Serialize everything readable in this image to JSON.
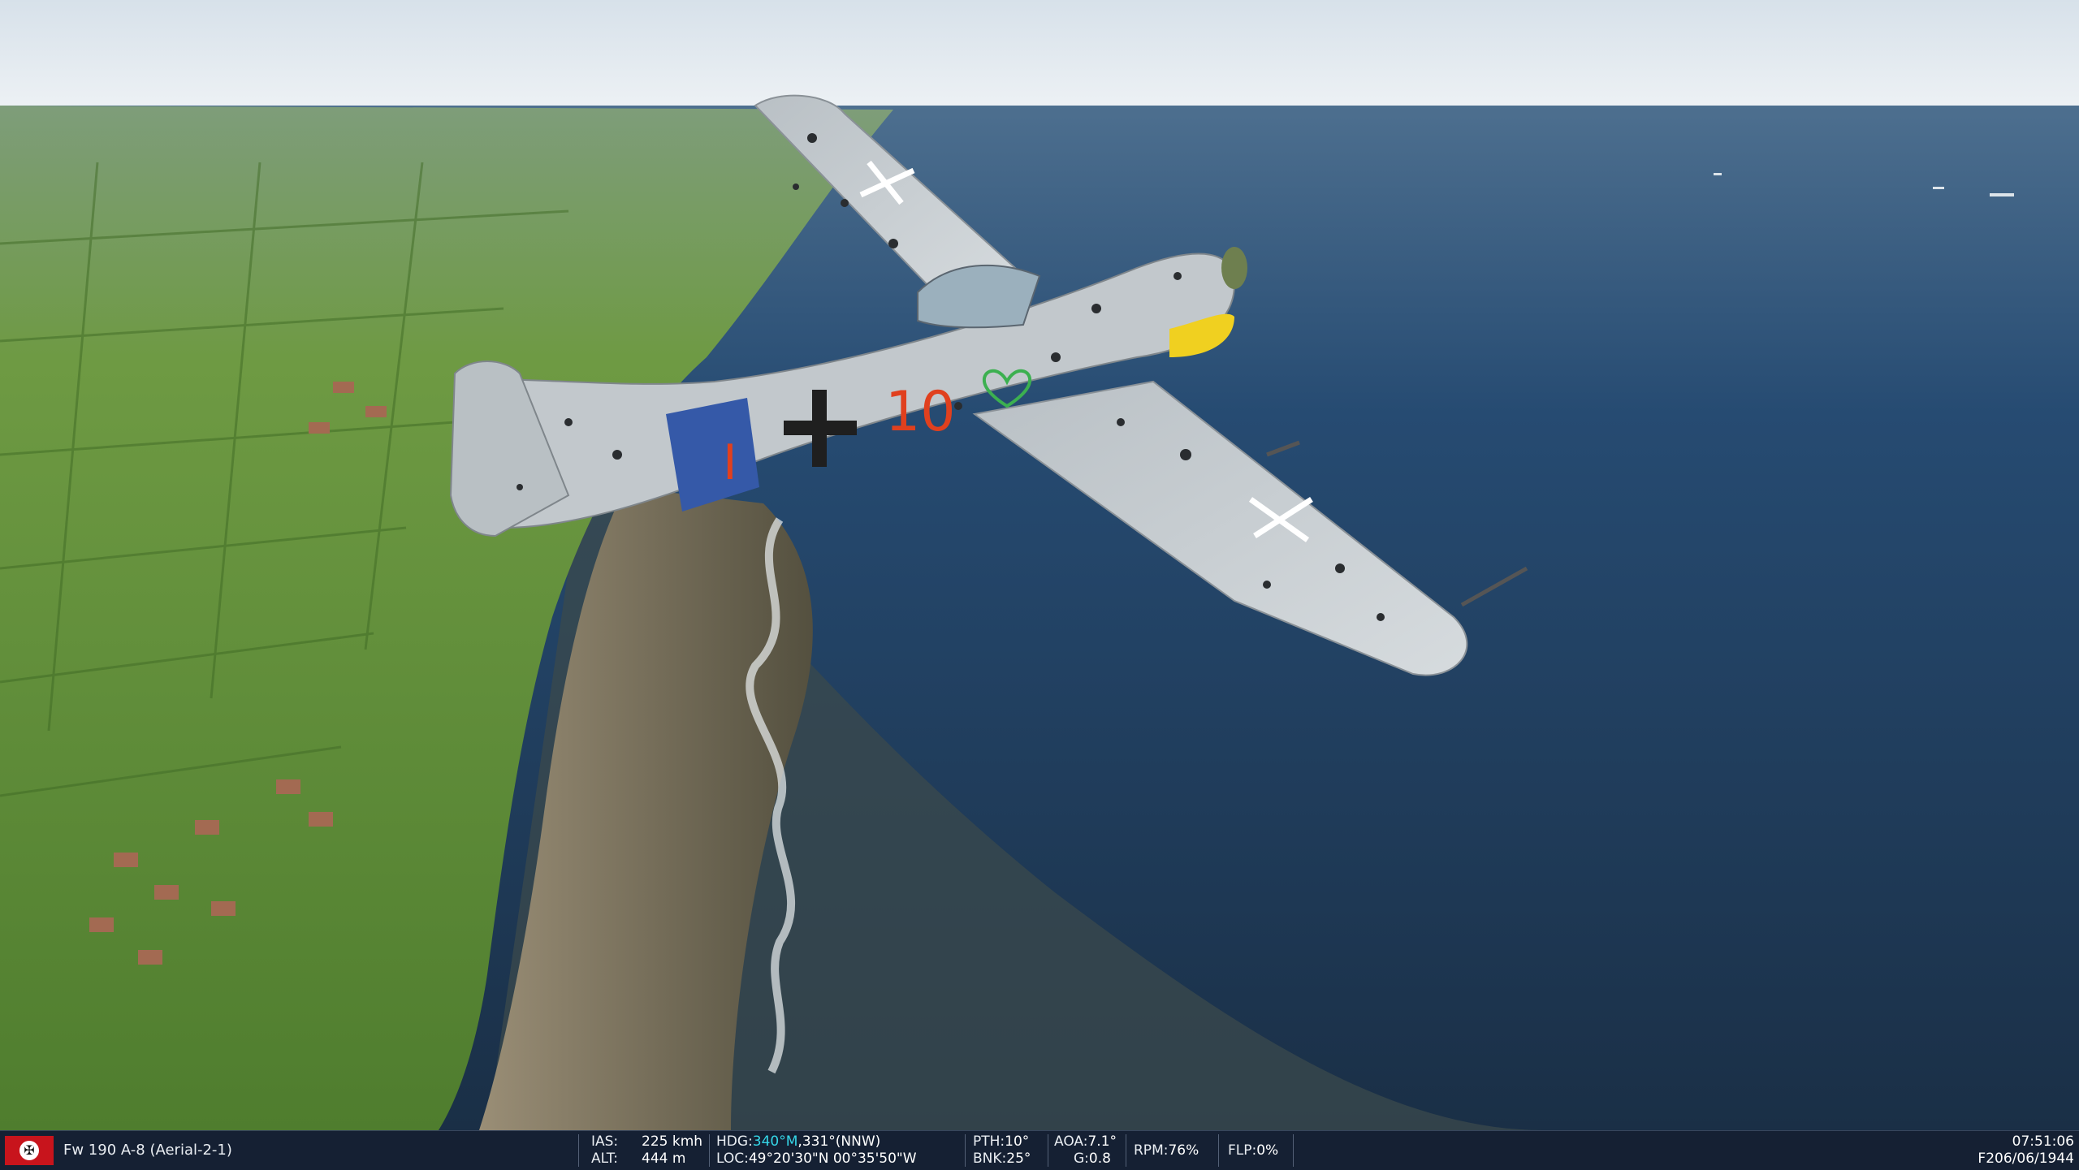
{
  "scene": {
    "description_icon": "aircraft-3d-view"
  },
  "statusbar": {
    "flag_icon": "german-cross-flag-icon",
    "aircraft": "Fw 190 A-8 (Aerial-2-1)",
    "ias_label": "IAS:",
    "ias_value": "225 kmh",
    "alt_label": "ALT:",
    "alt_value": "444 m",
    "hdg_label": "HDG:",
    "hdg_mag": "340°M",
    "hdg_rest": ",331°(NNW)",
    "loc_label": "LOC:",
    "loc_value": "49°20'30\"N 00°35'50\"W",
    "pth_label": "PTH:",
    "pth_value": "10°",
    "bnk_label": "BNK:",
    "bnk_value": "25°",
    "aoa_label": "AOA:",
    "aoa_value": "7.1°",
    "g_label": "G:",
    "g_value": "0.8",
    "rpm_label": "RPM:",
    "rpm_value": "76%",
    "flp_label": "FLP:",
    "flp_value": "0%",
    "time": "07:51:06",
    "date": "F206/06/1944"
  },
  "colors": {
    "bar_bg": "#162236",
    "heading_highlight": "#35d6e8",
    "sea": "#1d3a5c",
    "land": "#5f8a3a",
    "sky": "#dfe7ee"
  }
}
